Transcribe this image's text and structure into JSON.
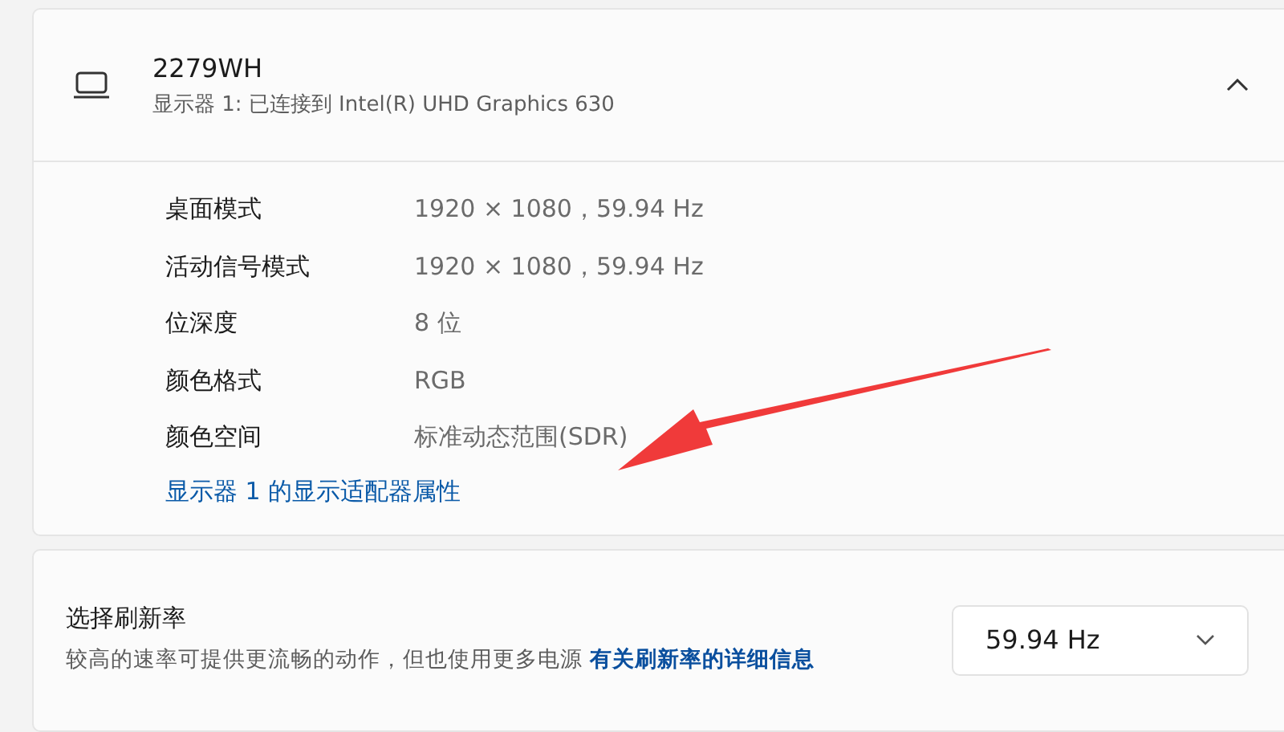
{
  "display": {
    "name": "2279WH",
    "subtitle": "显示器 1: 已连接到 Intel(R) UHD Graphics 630",
    "expanded": true,
    "properties": [
      {
        "label": "桌面模式",
        "value": "1920 × 1080，59.94 Hz"
      },
      {
        "label": "活动信号模式",
        "value": "1920 × 1080，59.94 Hz"
      },
      {
        "label": "位深度",
        "value": "8 位"
      },
      {
        "label": "颜色格式",
        "value": "RGB"
      },
      {
        "label": "颜色空间",
        "value": "标准动态范围(SDR)"
      }
    ],
    "adapter_link": "显示器 1 的显示适配器属性"
  },
  "refresh_rate": {
    "title": "选择刷新率",
    "description": "较高的速率可提供更流畅的动作，但也使用更多电源",
    "link": "有关刷新率的详细信息",
    "value": "59.94 Hz"
  }
}
